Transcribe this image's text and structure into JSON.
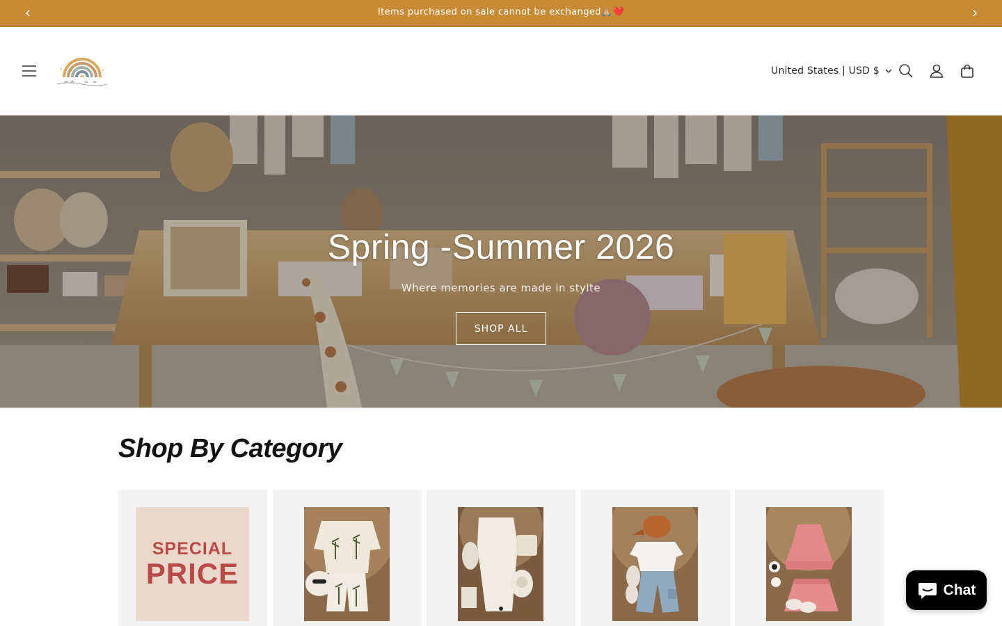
{
  "announcement": {
    "message": "Items purchased on sale cannot be exchanged🙏🏼❤️",
    "background": "#c88a34"
  },
  "header": {
    "menu_icon": "hamburger-icon",
    "logo_icon": "rainbow-logo",
    "country_selector": "United States | USD $",
    "icons": [
      "search-icon",
      "account-icon",
      "cart-icon"
    ]
  },
  "hero": {
    "title": "Spring -Summer 2026",
    "subtitle": "Where memories are made in stylte",
    "button_label": "SHOP ALL"
  },
  "categories": {
    "heading": "Shop By Category",
    "special_line1": "SPECIAL",
    "special_line2": "PRICE",
    "items": [
      {
        "image": "special-price-graphic"
      },
      {
        "image": "linen-set-with-palm-print"
      },
      {
        "image": "cream-outfit-with-plush-toy"
      },
      {
        "image": "white-tee-denim-and-cap"
      },
      {
        "image": "pink-ruffle-top-and-skirt"
      }
    ]
  },
  "chat": {
    "label": "Chat",
    "background": "#000000"
  }
}
